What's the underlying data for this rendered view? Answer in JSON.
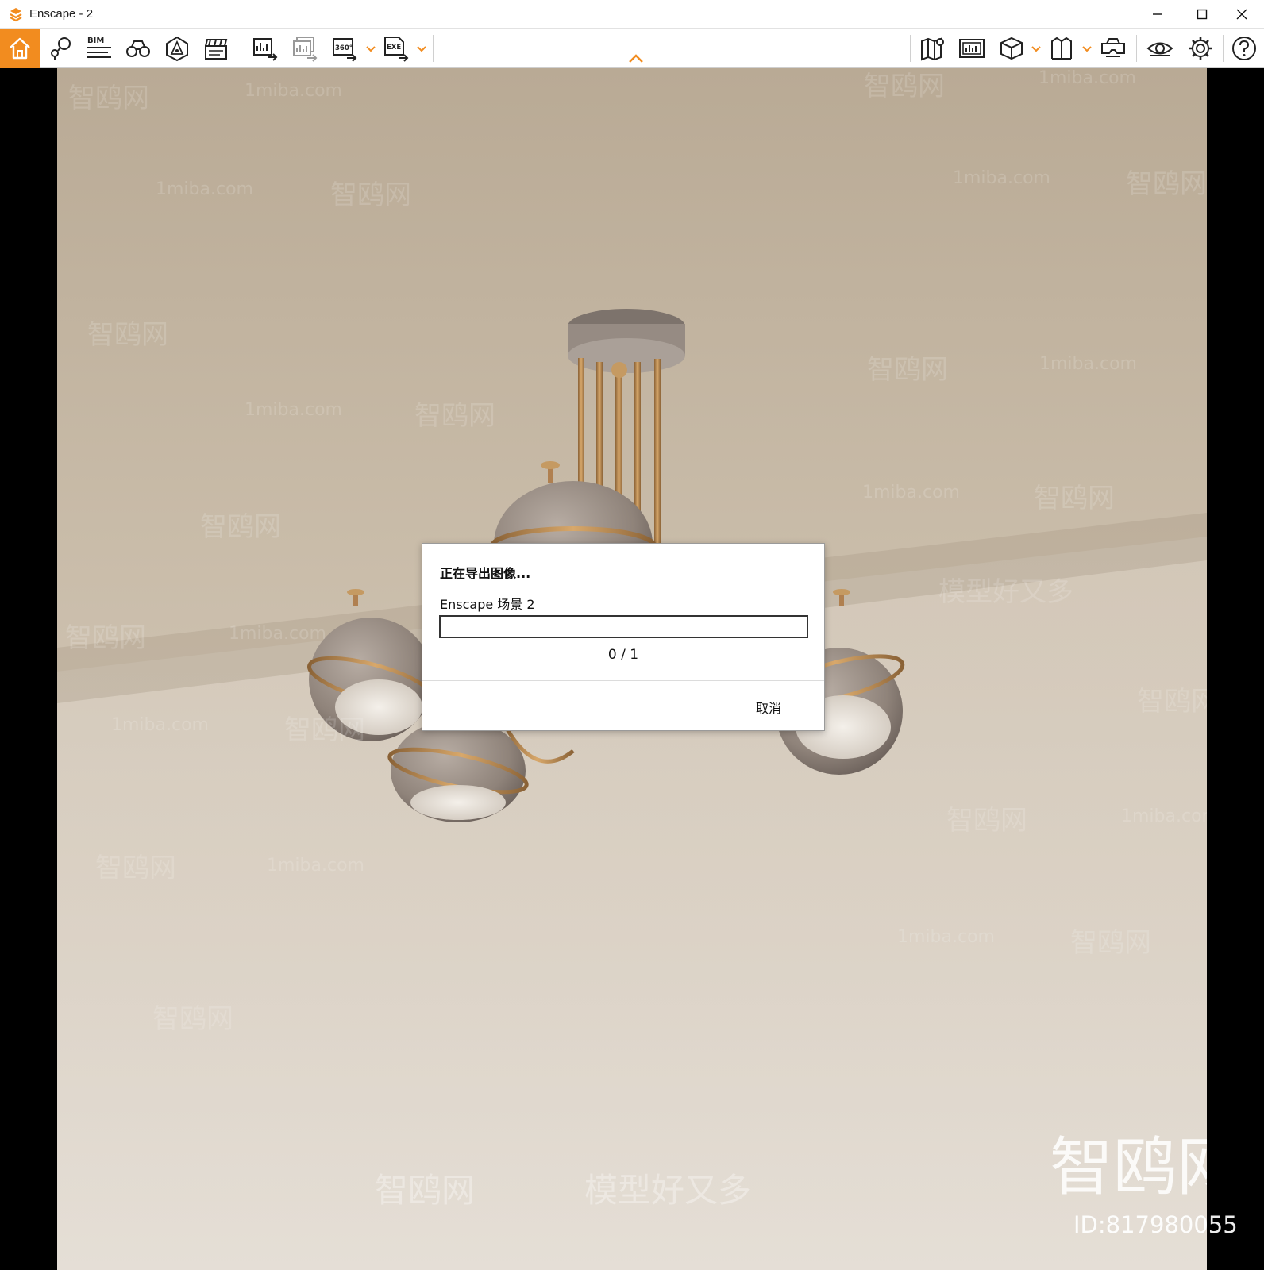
{
  "window": {
    "title": "Enscape - 2",
    "accent_color": "#f28c1f",
    "controls": [
      "minimize-icon",
      "maximize-icon",
      "close-icon"
    ]
  },
  "toolbar": {
    "home_icon": "home-icon",
    "bim_label": "BIM",
    "pano_label": "360°",
    "exe_label": "EXE",
    "left_tools": [
      "home-icon",
      "sync-views-icon",
      "bim-icon",
      "binoculars-icon",
      "asset-library-icon",
      "video-editor-icon",
      "render-image-icon",
      "batch-render-icon",
      "panorama-icon",
      "export-standalone-icon"
    ],
    "right_tools": [
      "map-icon",
      "render-image-icon",
      "view-mode-icon",
      "library-icon",
      "vr-headset-icon",
      "visibility-icon",
      "settings-icon",
      "help-icon"
    ]
  },
  "dialog": {
    "title": "正在导出图像...",
    "scene_name": "Enscape 场景 2",
    "progress_current": 0,
    "progress_total": 1,
    "progress_text": "0 / 1",
    "cancel_label": "取消"
  },
  "watermarks": {
    "site": "1miba.com",
    "brand": "智鸥网",
    "slogan": "模型好又多",
    "big_brand": "智鸥网",
    "id_text": "ID:817980055"
  }
}
